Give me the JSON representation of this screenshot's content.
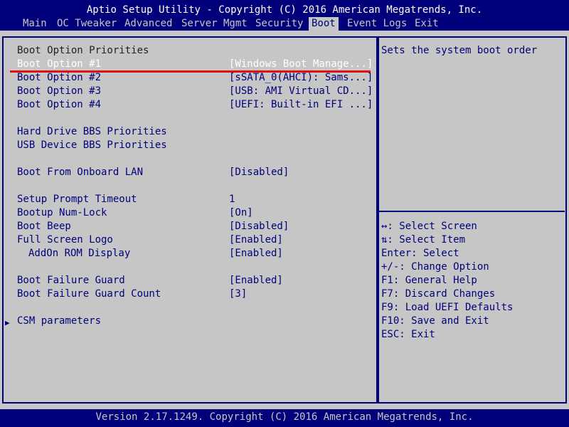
{
  "header": {
    "title": "Aptio Setup Utility - Copyright (C) 2016 American Megatrends, Inc."
  },
  "tabs": [
    "Main",
    "OC Tweaker",
    "Advanced",
    "Server Mgmt",
    "Security",
    "Boot",
    "Event Logs",
    "Exit"
  ],
  "active_tab": "Boot",
  "section_heading": "Boot Option Priorities",
  "boot_options": [
    {
      "label": "Boot Option #1",
      "value": "[Windows Boot Manage...]"
    },
    {
      "label": "Boot Option #2",
      "value": "[sSATA_0(AHCI): Sams...]"
    },
    {
      "label": "Boot Option #3",
      "value": "[USB: AMI Virtual CD...]"
    },
    {
      "label": "Boot Option #4",
      "value": "[UEFI: Built-in EFI ...]"
    }
  ],
  "links": [
    "Hard Drive BBS Priorities",
    "USB Device BBS Priorities"
  ],
  "settings": {
    "onboard_lan": {
      "label": "Boot From Onboard LAN",
      "value": "[Disabled]"
    },
    "prompt_timeout": {
      "label": "Setup Prompt Timeout",
      "value": "1"
    },
    "numlock": {
      "label": "Bootup Num-Lock",
      "value": "[On]"
    },
    "beep": {
      "label": "Boot Beep",
      "value": "[Disabled]"
    },
    "logo": {
      "label": "Full Screen Logo",
      "value": "[Enabled]"
    },
    "addon_rom": {
      "label": "AddOn ROM Display",
      "value": "[Enabled]"
    },
    "failure_guard": {
      "label": "Boot Failure Guard",
      "value": "[Enabled]"
    },
    "failure_guard_count": {
      "label": "Boot Failure Guard Count",
      "value": "[3]"
    }
  },
  "csm": {
    "label": "CSM parameters",
    "arrow": "▶"
  },
  "help": {
    "description": "Sets the system boot order",
    "keys": [
      "↔: Select Screen",
      "⇅: Select Item",
      "Enter: Select",
      "+/-: Change Option",
      "F1: General Help",
      "F7: Discard Changes",
      "F9: Load UEFI Defaults",
      "F10: Save and Exit",
      "ESC: Exit"
    ]
  },
  "footer": {
    "text": "Version 2.17.1249. Copyright (C) 2016 American Megatrends, Inc."
  },
  "colors": {
    "background": "#00007a",
    "panel": "#c6c6c6",
    "highlight": "#ffffff",
    "annotation_underline": "#e01010"
  }
}
